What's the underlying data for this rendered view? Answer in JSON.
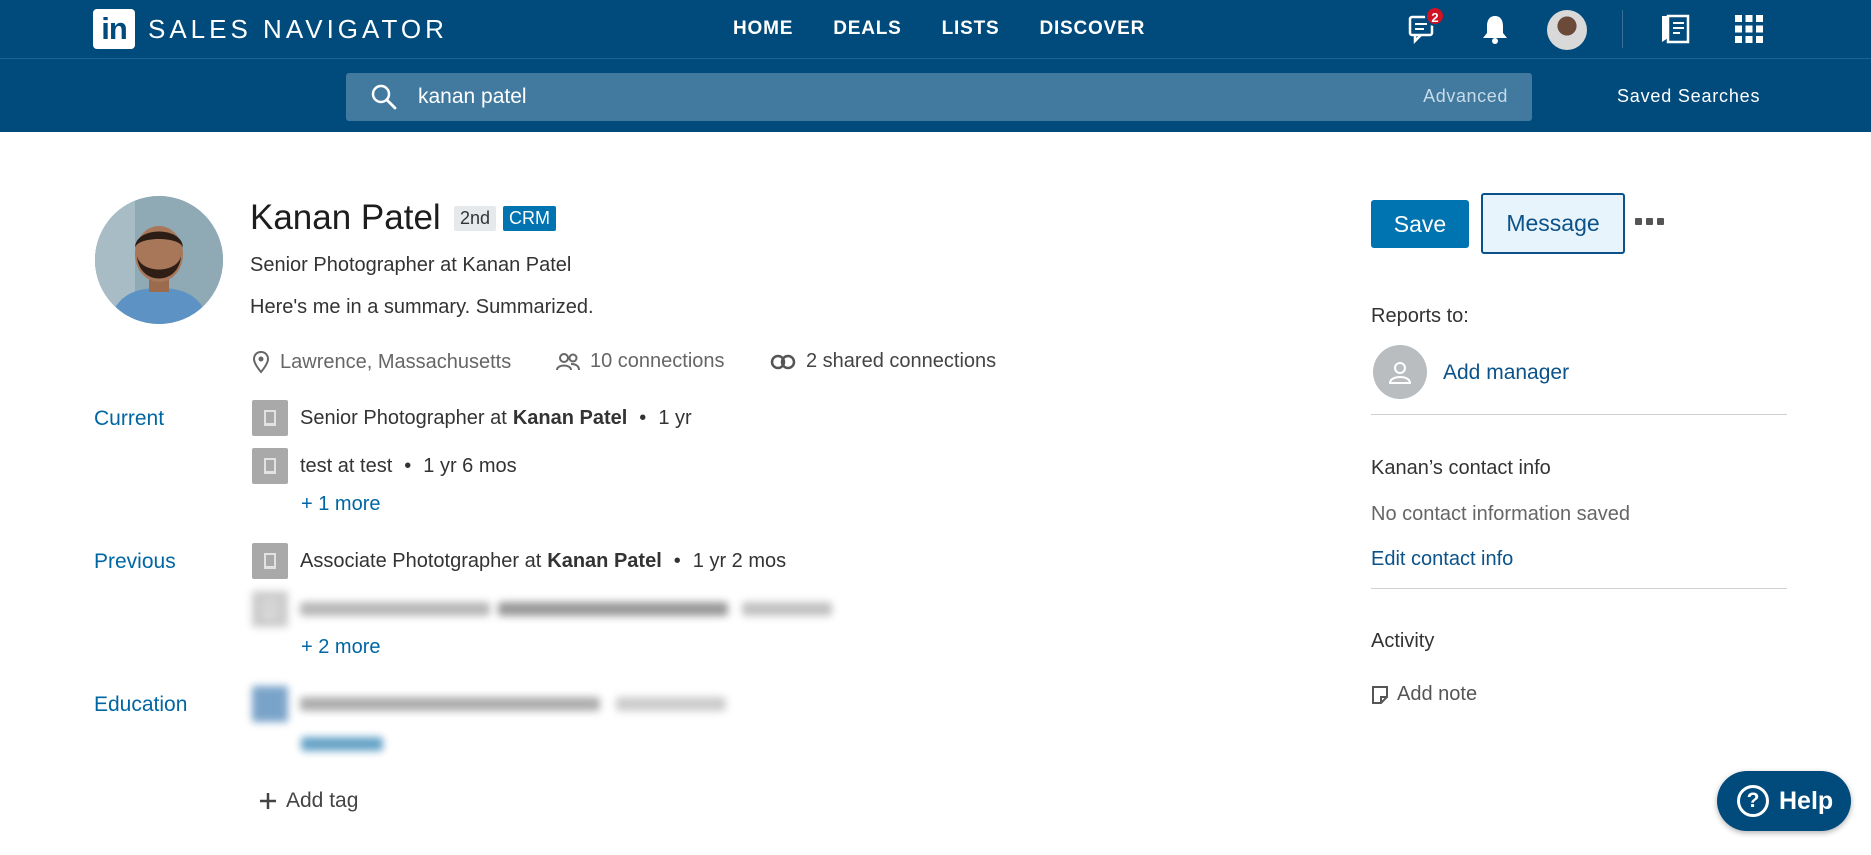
{
  "header": {
    "logo_text": "in",
    "brand": "SALES NAVIGATOR",
    "nav": [
      "HOME",
      "DEALS",
      "LISTS",
      "DISCOVER"
    ],
    "message_badge": "2"
  },
  "search": {
    "query": "kanan patel",
    "advanced_label": "Advanced",
    "saved_searches_label": "Saved Searches"
  },
  "profile": {
    "name": "Kanan Patel",
    "degree": "2nd",
    "crm_label": "CRM",
    "headline": "Senior Photographer at Kanan Patel",
    "summary": "Here's me in a summary. Summarized.",
    "location": "Lawrence, Massachusetts",
    "connections": "10 connections",
    "shared_connections": "2 shared connections"
  },
  "current": {
    "label": "Current",
    "positions": [
      {
        "title": "Senior Photographer at",
        "company": "Kanan Patel",
        "duration": "1 yr"
      },
      {
        "title": "test at test",
        "company": "",
        "duration": "1 yr 6 mos"
      }
    ],
    "more": "+ 1 more"
  },
  "previous": {
    "label": "Previous",
    "positions": [
      {
        "title": "Associate Phototgrapher at",
        "company": "Kanan Patel",
        "duration": "1 yr 2 mos"
      }
    ],
    "more": "+ 2 more"
  },
  "education": {
    "label": "Education"
  },
  "add_tag": "Add tag",
  "actions": {
    "save": "Save",
    "message": "Message"
  },
  "right": {
    "reports_to": "Reports to:",
    "add_manager": "Add manager",
    "contact_title": "Kanan’s contact info",
    "no_contact": "No contact information saved",
    "edit_contact": "Edit contact info",
    "activity": "Activity",
    "add_note": "Add note"
  },
  "help": "Help",
  "colors": {
    "brand_blue": "#004b7c",
    "link_blue": "#0066a3",
    "button_blue": "#0073b1",
    "badge_red": "#d11124"
  }
}
